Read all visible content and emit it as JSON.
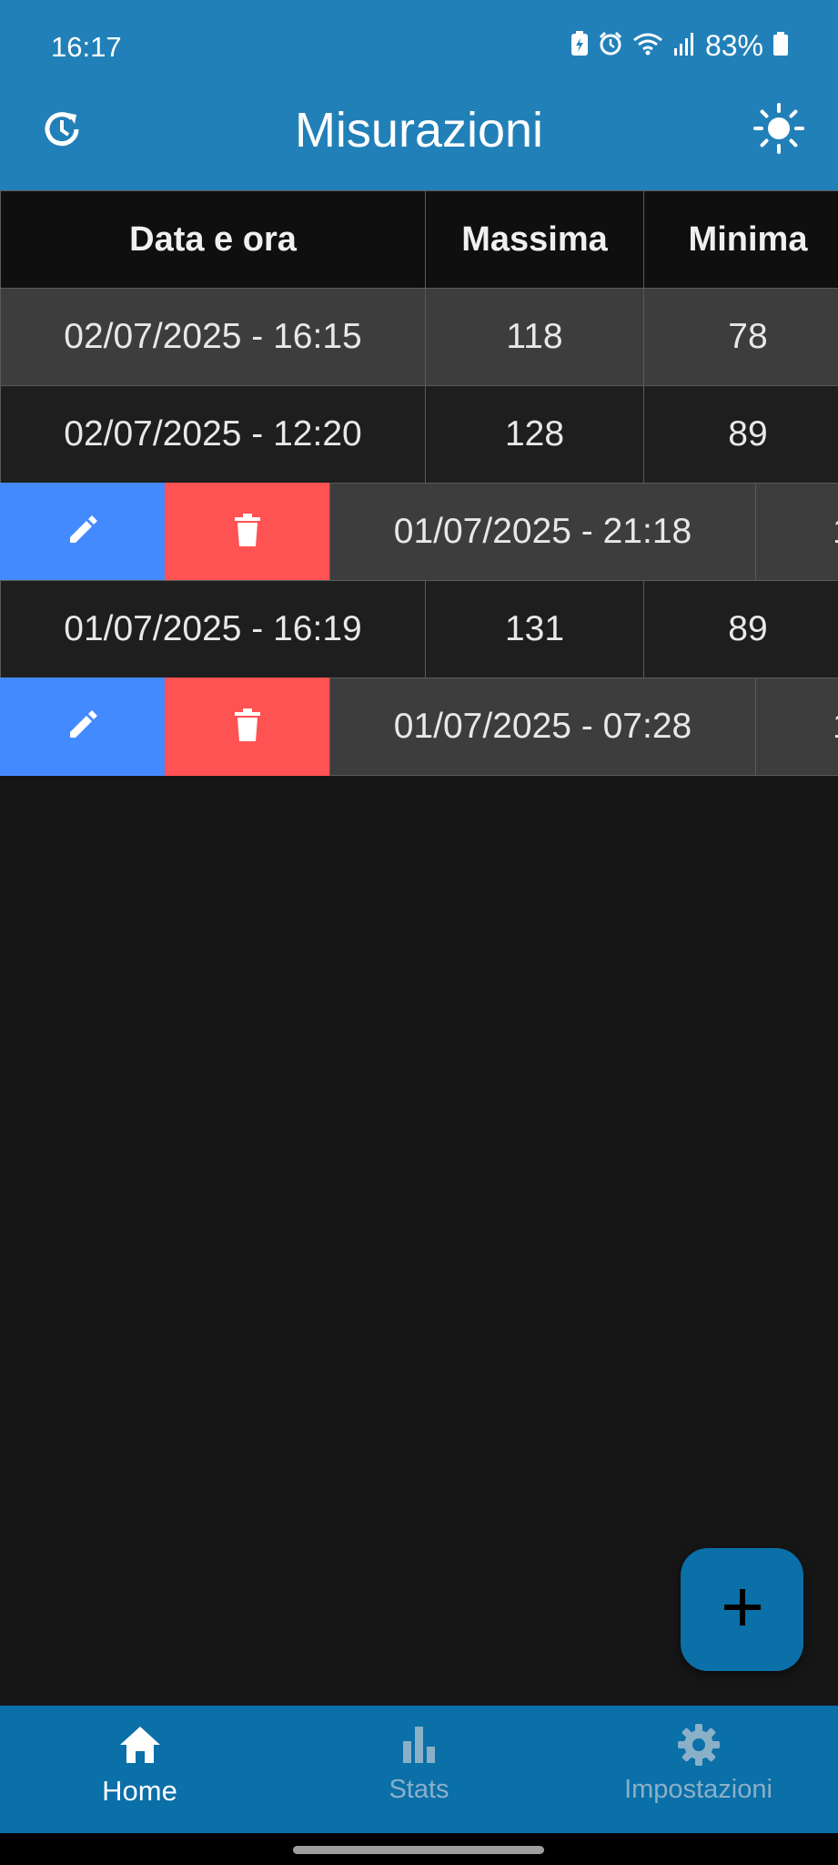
{
  "status_bar": {
    "time": "16:17",
    "battery_percent": "83%",
    "icons": [
      "battery-saver-icon",
      "alarm-icon",
      "wifi-icon",
      "signal-icon",
      "battery-icon"
    ]
  },
  "app_bar": {
    "title": "Misurazioni",
    "left_icon": "history-icon",
    "right_icon": "brightness-icon"
  },
  "table": {
    "headers": [
      "Data e ora",
      "Massima",
      "Minima"
    ],
    "rows": [
      {
        "datetime": "02/07/2025 - 16:15",
        "max": "118",
        "min": "78"
      },
      {
        "datetime": "02/07/2025 - 12:20",
        "max": "128",
        "min": "89"
      },
      {
        "datetime": "01/07/2025 - 21:18",
        "max": "1",
        "swiped": true
      },
      {
        "datetime": "01/07/2025 - 16:19",
        "max": "131",
        "min": "89"
      },
      {
        "datetime": "01/07/2025 - 07:28",
        "max": "1",
        "swiped": true
      }
    ]
  },
  "colors": {
    "app_bar": "#2280b8",
    "bottom_nav": "#0b6fa8",
    "edit_action": "#448aff",
    "delete_action": "#ff5252",
    "background": "#161616"
  },
  "fab": {
    "icon": "add-icon"
  },
  "bottom_nav": {
    "items": [
      {
        "label": "Home",
        "icon": "home-icon",
        "active": true
      },
      {
        "label": "Stats",
        "icon": "bar-chart-icon",
        "active": false
      },
      {
        "label": "Impostazioni",
        "icon": "gear-icon",
        "active": false
      }
    ]
  }
}
